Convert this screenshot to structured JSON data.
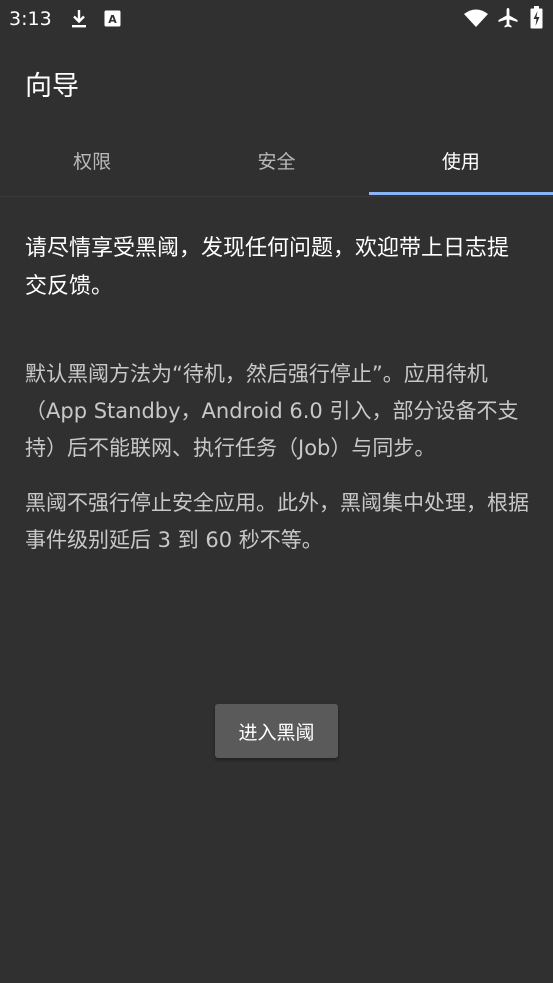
{
  "status_bar": {
    "time": "3:13",
    "icons": [
      "download-icon",
      "notification-a-icon",
      "wifi-icon",
      "airplane-icon",
      "battery-icon"
    ],
    "notification_badge": "A"
  },
  "toolbar": {
    "title": "向导"
  },
  "tabs": [
    {
      "label": "权限",
      "active": false
    },
    {
      "label": "安全",
      "active": false
    },
    {
      "label": "使用",
      "active": true
    }
  ],
  "accent_color": "#8ab4f8",
  "content": {
    "intro": "请尽情享受黑阈，发现任何问题，欢迎带上日志提交反馈。",
    "paragraph1": "默认黑阈方法为“待机，然后强行停止”。应用待机（App Standby，Android 6.0 引入，部分设备不支持）后不能联网、执行任务（Job）与同步。",
    "paragraph2": "黑阈不强行停止安全应用。此外，黑阈集中处理，根据事件级别延后 3 到 60 秒不等。"
  },
  "actions": {
    "enter_label": "进入黑阈"
  }
}
